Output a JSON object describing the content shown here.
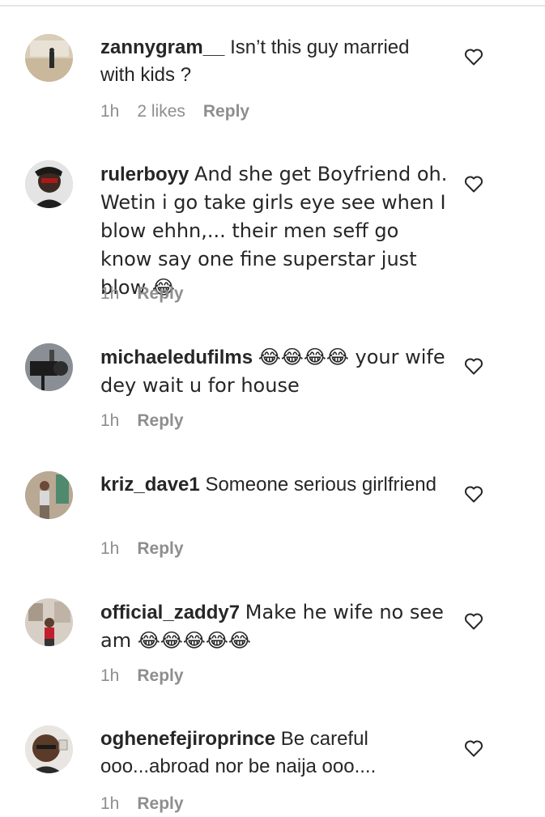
{
  "comments": [
    {
      "username": "zannygram__",
      "text": "Isn’t this guy married with kids ?",
      "time": "1h",
      "likes": "2 likes",
      "reply": "Reply",
      "avatar_icon": "user-avatar"
    },
    {
      "username": "rulerboyy",
      "text": "And she get Boyfriend oh. Wetin i go take girls eye see when I blow ehhn,... their men seff go know say one fine superstar just blow 😂",
      "time": "1h",
      "reply": "Reply",
      "avatar_icon": "user-avatar"
    },
    {
      "username": "michaeledufilms",
      "text": "😂😂😂😂 your wife dey wait u for house",
      "time": "1h",
      "reply": "Reply",
      "avatar_icon": "user-avatar"
    },
    {
      "username": "kriz_dave1",
      "text": "Someone serious girlfriend",
      "time": "1h",
      "reply": "Reply",
      "avatar_icon": "user-avatar"
    },
    {
      "username": "official_zaddy7",
      "text": "Make he wife no see am 😂😂😂😂😂",
      "time": "1h",
      "reply": "Reply",
      "avatar_icon": "user-avatar"
    },
    {
      "username": "oghenefejiroprince",
      "text": "Be careful ooo...abroad nor be naija ooo....",
      "time": "1h",
      "reply": "Reply",
      "avatar_icon": "user-avatar"
    }
  ],
  "colors": {
    "text": "#262626",
    "meta": "#8e8e8e",
    "divider": "#e6e6e6"
  }
}
